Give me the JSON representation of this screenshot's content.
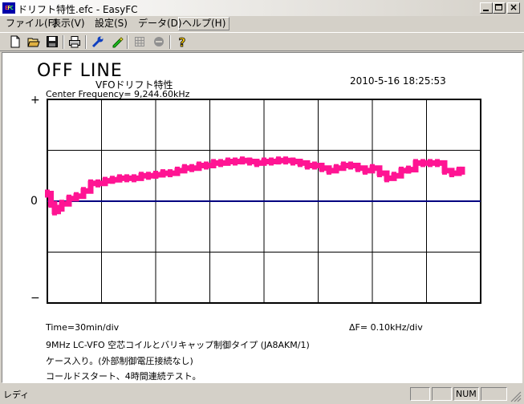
{
  "window": {
    "title": "ドリフト特性.efc - EasyFC",
    "icon_text": [
      "E",
      "F",
      "C"
    ],
    "controls": [
      "minimize-icon",
      "maximize-icon",
      "close-icon"
    ],
    "close_glyph": "×"
  },
  "menu": [
    {
      "label": "ファイル(F)"
    },
    {
      "label": "表示(V)"
    },
    {
      "label": "設定(S)"
    },
    {
      "label": "データ(D)"
    },
    {
      "label": "ヘルプ(H)"
    }
  ],
  "toolbar": {
    "buttons": [
      "new-file-icon",
      "open-folder-icon",
      "save-disk-icon",
      "print-icon",
      "wrench-icon",
      "pen-icon",
      "grid-icon",
      "stop-icon",
      "help-icon"
    ]
  },
  "display": {
    "status": "OFF LINE",
    "title": "VFOドリフト特性",
    "datetime": "2010-5-16  18:25:53",
    "center_frequency": "Center Frequency=  9,244.60kHz",
    "plus_label": "+",
    "zero_label": "0",
    "minus_label": "−",
    "time_div": "Time=30min/div",
    "delta_f": "ΔF=     0.10kHz/div",
    "note1": "9MHz LC-VFO  空芯コイルとバリキャップ制御タイプ (JA8AKM/1)",
    "note2": "ケース入り。(外部制御電圧接続なし)",
    "note3": "コールドスタート、4時間連続テスト。"
  },
  "chart_data": {
    "type": "line",
    "x_unit": "min",
    "y_unit": "kHz deviation from center frequency",
    "xlim": [
      0,
      240
    ],
    "ylim": [
      -0.2,
      0.2
    ],
    "grid": true,
    "series_color": "#ff1493",
    "baseline_color": "#000080",
    "series": [
      {
        "x": [
          0,
          2,
          4,
          6,
          8,
          12,
          16,
          20,
          24,
          28,
          32,
          36,
          40,
          44,
          48,
          52,
          56,
          60,
          64,
          68,
          72,
          76,
          80,
          84,
          88,
          92,
          96,
          100,
          104,
          108,
          112,
          116,
          120,
          124,
          128,
          132,
          136,
          140,
          144,
          148,
          152,
          156,
          160,
          164,
          168,
          172,
          176,
          180,
          184,
          188,
          192,
          196,
          200,
          204,
          208,
          212,
          216,
          220,
          224,
          228,
          230
        ],
        "values": [
          0.015,
          -0.005,
          -0.02,
          -0.015,
          -0.005,
          0.005,
          0.01,
          0.02,
          0.035,
          0.035,
          0.04,
          0.042,
          0.045,
          0.045,
          0.045,
          0.05,
          0.05,
          0.052,
          0.055,
          0.055,
          0.06,
          0.065,
          0.065,
          0.07,
          0.07,
          0.075,
          0.075,
          0.078,
          0.078,
          0.08,
          0.078,
          0.075,
          0.078,
          0.078,
          0.08,
          0.08,
          0.078,
          0.075,
          0.07,
          0.07,
          0.065,
          0.06,
          0.065,
          0.07,
          0.07,
          0.065,
          0.06,
          0.065,
          0.055,
          0.045,
          0.05,
          0.06,
          0.062,
          0.075,
          0.075,
          0.075,
          0.075,
          0.06,
          0.055,
          0.06,
          0.06
        ]
      }
    ]
  },
  "status": {
    "left": "レディ",
    "cells": [
      "",
      "",
      "NUM",
      ""
    ]
  }
}
